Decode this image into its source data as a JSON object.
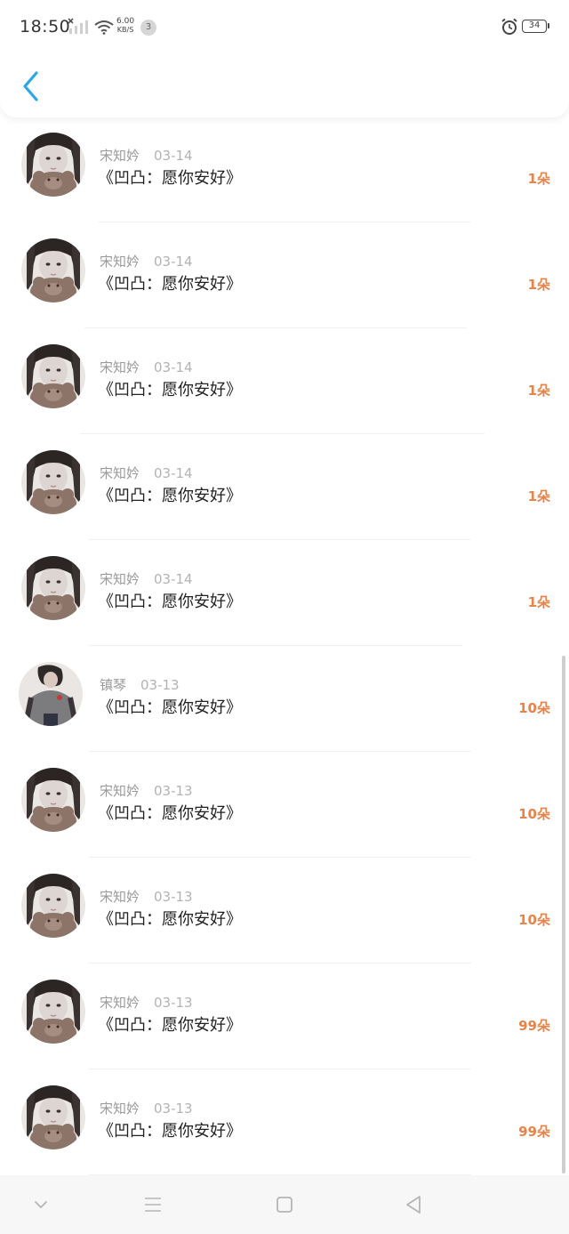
{
  "status_bar": {
    "time": "18:50",
    "net_speed_value": "6.00",
    "net_speed_unit": "KB/S",
    "notification_count": "3",
    "battery_level": "34"
  },
  "header": {
    "back_icon": "chevron-left-icon"
  },
  "colors": {
    "accent_blue": "#2aa7e8",
    "flower_orange": "#e8834a",
    "username_gray": "#9a9a9a",
    "title_dark": "#222222"
  },
  "gifts": [
    {
      "user": "宋知妗",
      "date": "03-14",
      "title": "《凹凸：愿你安好》",
      "count": "1朵",
      "avatar": "girl-with-bear"
    },
    {
      "user": "宋知妗",
      "date": "03-14",
      "title": "《凹凸：愿你安好》",
      "count": "1朵",
      "avatar": "girl-with-bear"
    },
    {
      "user": "宋知妗",
      "date": "03-14",
      "title": "《凹凸：愿你安好》",
      "count": "1朵",
      "avatar": "girl-with-bear"
    },
    {
      "user": "宋知妗",
      "date": "03-14",
      "title": "《凹凸：愿你安好》",
      "count": "1朵",
      "avatar": "girl-with-bear"
    },
    {
      "user": "宋知妗",
      "date": "03-14",
      "title": "《凹凸：愿你安好》",
      "count": "1朵",
      "avatar": "girl-with-bear"
    },
    {
      "user": "镇琴",
      "date": "03-13",
      "title": "《凹凸：愿你安好》",
      "count": "10朵",
      "avatar": "character-gray-hoodie"
    },
    {
      "user": "宋知妗",
      "date": "03-13",
      "title": "《凹凸：愿你安好》",
      "count": "10朵",
      "avatar": "girl-with-bear"
    },
    {
      "user": "宋知妗",
      "date": "03-13",
      "title": "《凹凸：愿你安好》",
      "count": "10朵",
      "avatar": "girl-with-bear"
    },
    {
      "user": "宋知妗",
      "date": "03-13",
      "title": "《凹凸：愿你安好》",
      "count": "99朵",
      "avatar": "girl-with-bear"
    },
    {
      "user": "宋知妗",
      "date": "03-13",
      "title": "《凹凸：愿你安好》",
      "count": "99朵",
      "avatar": "girl-with-bear"
    }
  ],
  "nav_bar": {
    "buttons": [
      "collapse-icon",
      "menu-icon",
      "home-icon",
      "back-icon"
    ]
  }
}
